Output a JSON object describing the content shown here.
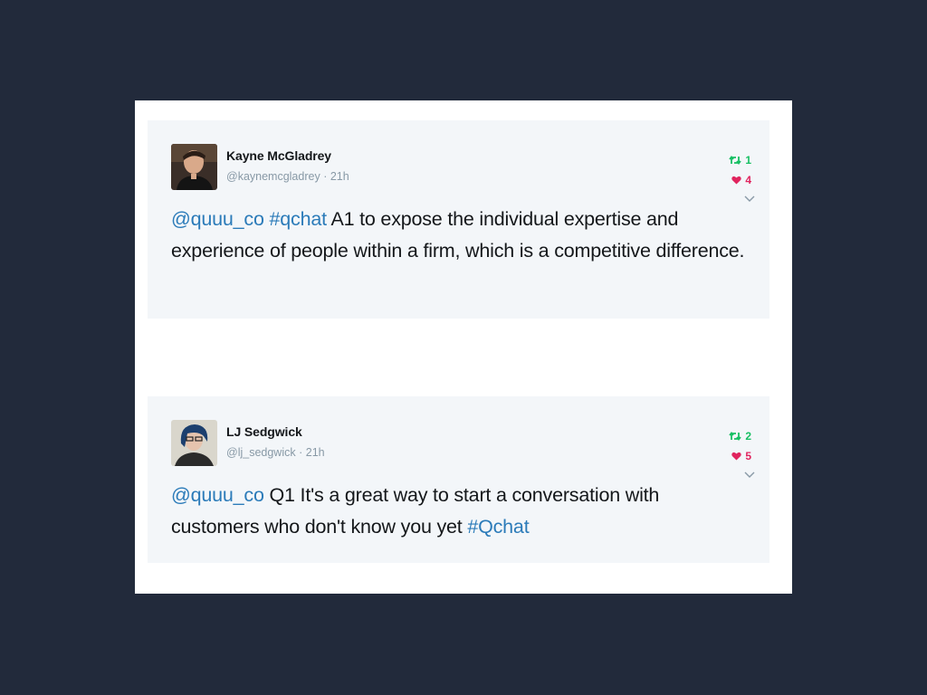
{
  "tweets": [
    {
      "name": "Kayne McGladrey",
      "handle": "@kaynemcgladrey",
      "sep": "·",
      "time": "21h",
      "retweets": "1",
      "likes": "4",
      "text": [
        {
          "t": "@quuu_co",
          "link": true
        },
        {
          "t": " ",
          "link": false
        },
        {
          "t": "#qchat",
          "link": true
        },
        {
          "t": " A1 to expose the individual expertise and experience of people within a firm, which is a competitive difference.",
          "link": false
        }
      ]
    },
    {
      "name": "LJ Sedgwick",
      "handle": "@lj_sedgwick",
      "sep": "·",
      "time": "21h",
      "retweets": "2",
      "likes": "5",
      "text": [
        {
          "t": "@quuu_co",
          "link": true
        },
        {
          "t": " Q1 It's a great way to start a conversation with customers who don't know you yet ",
          "link": false
        },
        {
          "t": "#Qchat",
          "link": true
        }
      ]
    }
  ],
  "colors": {
    "background": "#222a3b",
    "card": "#f3f6f9",
    "link": "#2b7bb9",
    "retweet": "#17bf63",
    "like": "#e0245e"
  },
  "icons": {
    "retweet": "retweet-icon",
    "like": "heart-icon",
    "caret": "chevron-down-icon"
  }
}
